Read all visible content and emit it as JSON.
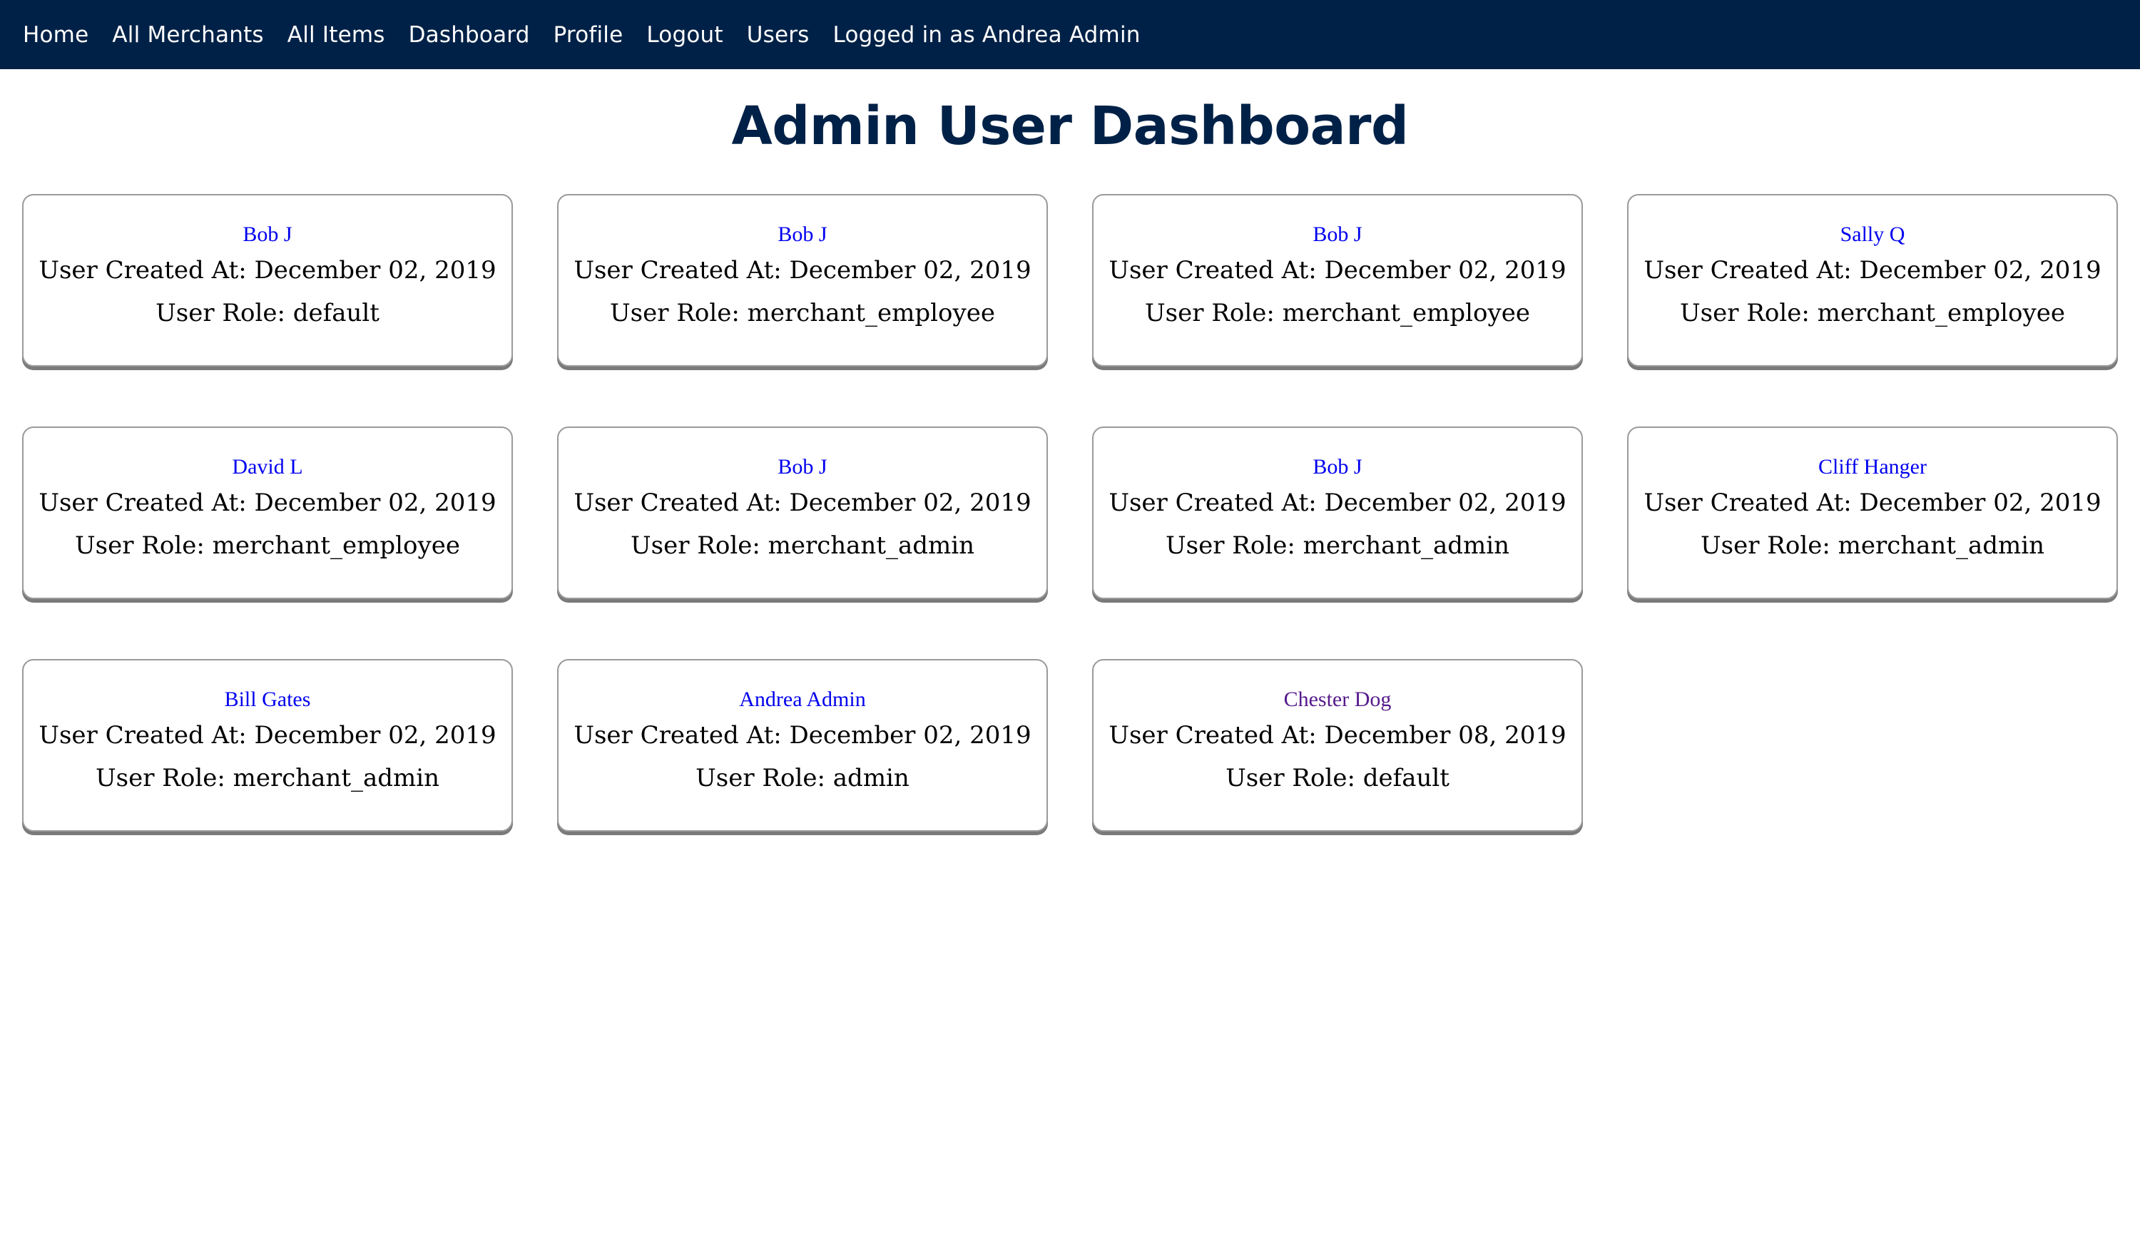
{
  "nav": {
    "links": [
      "Home",
      "All Merchants",
      "All Items",
      "Dashboard",
      "Profile",
      "Logout",
      "Users"
    ],
    "status": "Logged in as Andrea Admin",
    "background": "#002147"
  },
  "page": {
    "title": "Admin User Dashboard",
    "created_prefix": "User Created At: ",
    "role_prefix": "User Role: "
  },
  "users": [
    {
      "name": "Bob J",
      "created": "December 02, 2019",
      "role": "default",
      "visited": false
    },
    {
      "name": "Bob J",
      "created": "December 02, 2019",
      "role": "merchant_employee",
      "visited": false
    },
    {
      "name": "Bob J",
      "created": "December 02, 2019",
      "role": "merchant_employee",
      "visited": false
    },
    {
      "name": "Sally Q",
      "created": "December 02, 2019",
      "role": "merchant_employee",
      "visited": false
    },
    {
      "name": "David L",
      "created": "December 02, 2019",
      "role": "merchant_employee",
      "visited": false
    },
    {
      "name": "Bob J",
      "created": "December 02, 2019",
      "role": "merchant_admin",
      "visited": false
    },
    {
      "name": "Bob J",
      "created": "December 02, 2019",
      "role": "merchant_admin",
      "visited": false
    },
    {
      "name": "Cliff Hanger",
      "created": "December 02, 2019",
      "role": "merchant_admin",
      "visited": false
    },
    {
      "name": "Bill Gates",
      "created": "December 02, 2019",
      "role": "merchant_admin",
      "visited": false
    },
    {
      "name": "Andrea Admin",
      "created": "December 02, 2019",
      "role": "admin",
      "visited": false
    },
    {
      "name": "Chester Dog",
      "created": "December 08, 2019",
      "role": "default",
      "visited": true
    }
  ],
  "colors": {
    "link": "#0000ee",
    "visited_link": "#551a8b",
    "title": "#002147"
  }
}
